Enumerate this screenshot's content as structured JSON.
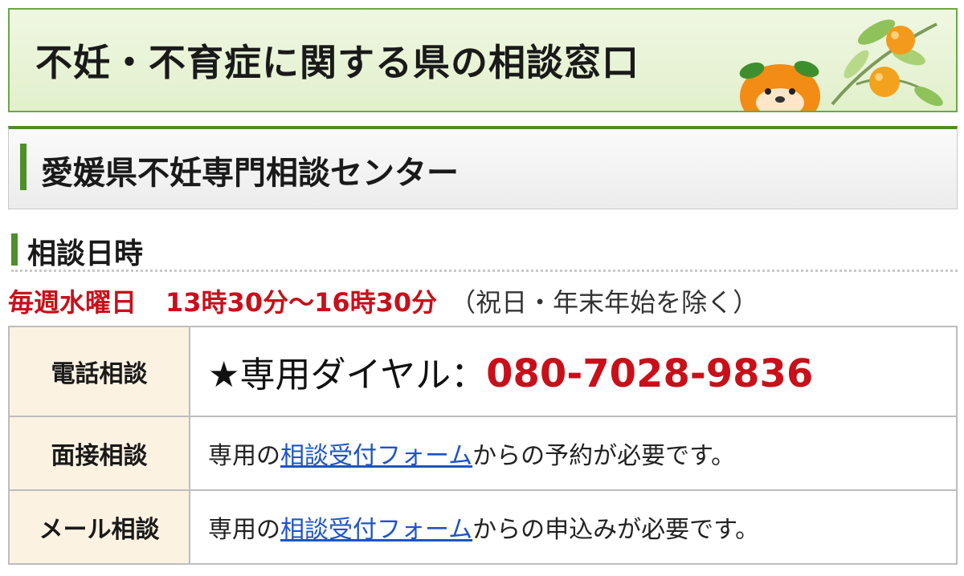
{
  "banner": {
    "title": "不妊・不育症に関する県の相談窓口",
    "mascot_icon": "mikan-mascot-icon"
  },
  "section": {
    "title": "愛媛県不妊専門相談センター"
  },
  "schedule": {
    "heading": "相談日時",
    "day": "毎週水曜日",
    "time": "13時30分〜16時30分",
    "note": "（祝日・年末年始を除く）"
  },
  "table": {
    "rows": [
      {
        "label": "電話相談",
        "prefix": "★専用ダイヤル：",
        "phone": "080-7028-9836"
      },
      {
        "label": "面接相談",
        "pre": "専用の",
        "link": "相談受付フォーム",
        "post": "からの予約が必要です。"
      },
      {
        "label": "メール相談",
        "pre": "専用の",
        "link": "相談受付フォーム",
        "post": "からの申込みが必要です。"
      }
    ]
  },
  "colors": {
    "accent_green": "#4e8f2a",
    "alert_red": "#c8101a",
    "link_blue": "#1d53c9",
    "label_bg": "#fcf2e2"
  }
}
